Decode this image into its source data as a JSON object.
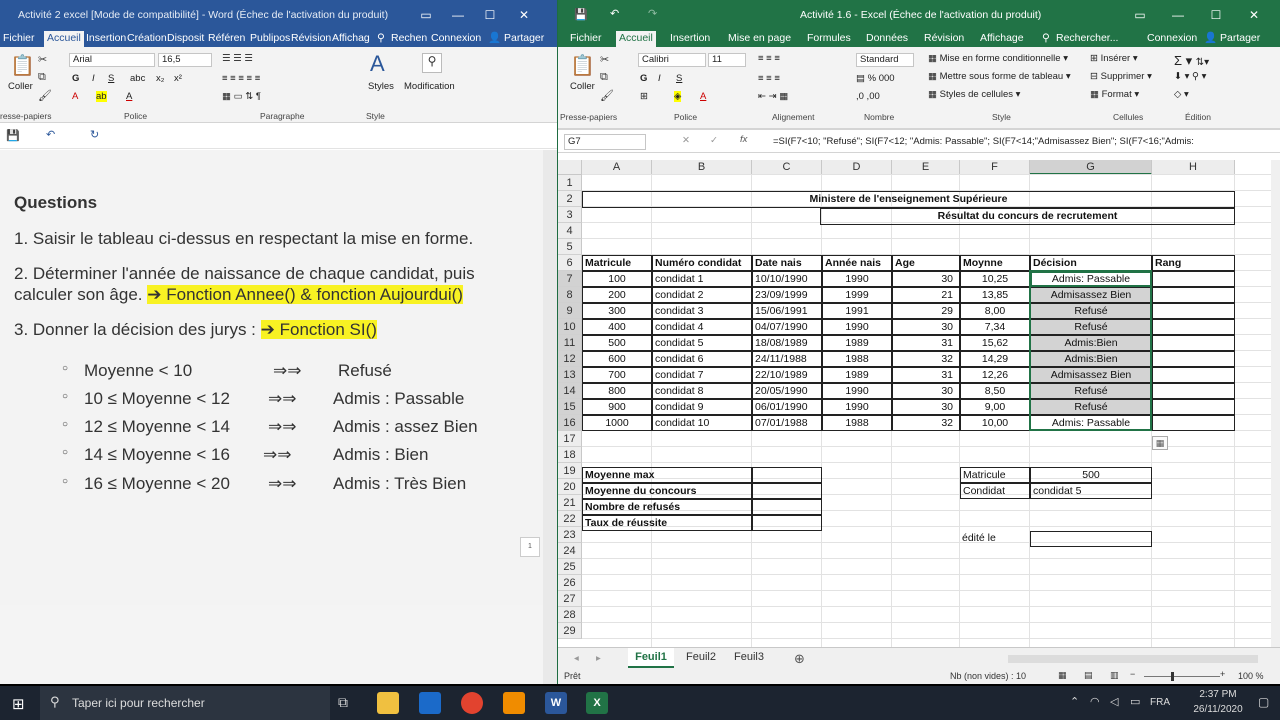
{
  "word": {
    "title": "Activité 2 excel [Mode de compatibilité] - Word (Échec de l'activation du produit)",
    "tabs": [
      "Fichier",
      "Accueil",
      "Insertion",
      "Création",
      "Disposit",
      "Référen",
      "Publipos",
      "Révision",
      "Affichag"
    ],
    "search": "Rechen",
    "connexion": "Connexion",
    "share": "Partager",
    "ribbon": {
      "paste": "Coller",
      "font": "Arial",
      "size": "16,5",
      "styles": "Styles",
      "modification": "Modification",
      "groups": [
        "resse-papiers",
        "Police",
        "Paragraphe",
        "Style"
      ]
    },
    "doc": {
      "heading": "Questions",
      "q1": "1. Saisir le tableau ci-dessus en respectant la mise en forme.",
      "q2a": "2. Déterminer l'année de naissance de chaque candidat, puis",
      "q2b": "calculer son âge.",
      "q2hl": "➔ Fonction Annee() & fonction Aujourdui()",
      "q3": "3. Donner la décision des jurys :",
      "q3hl": "➔ Fonction SI()",
      "rules": [
        {
          "cond": "Moyenne < 10",
          "arrow": "⇒⇒",
          "res": "Refusé"
        },
        {
          "cond": "10 ≤ Moyenne < 12",
          "arrow": "⇒⇒",
          "res": "Admis : Passable"
        },
        {
          "cond": "12 ≤ Moyenne < 14",
          "arrow": "⇒⇒",
          "res": "Admis : assez Bien"
        },
        {
          "cond": "14 ≤ Moyenne < 16",
          "arrow": "⇒⇒",
          "res": "Admis : Bien"
        },
        {
          "cond": "16 ≤ Moyenne < 20",
          "arrow": "⇒⇒",
          "res": "Admis : Très Bien"
        }
      ],
      "page_marker": "1"
    }
  },
  "excel": {
    "title": "Activité 1.6 - Excel (Échec de l'activation du produit)",
    "tabs": [
      "Fichier",
      "Accueil",
      "Insertion",
      "Mise en page",
      "Formules",
      "Données",
      "Révision",
      "Affichage"
    ],
    "search": "Rechercher...",
    "connexion": "Connexion",
    "share": "Partager",
    "ribbon": {
      "paste": "Coller",
      "font": "Calibri",
      "size": "11",
      "numformat": "Standard",
      "cond_format": "Mise en forme conditionnelle",
      "table_format": "Mettre sous forme de tableau",
      "cell_styles": "Styles de cellules",
      "insert": "Insérer",
      "delete": "Supprimer",
      "format": "Format",
      "groups": [
        "Presse-papiers",
        "Police",
        "Alignement",
        "Nombre",
        "Style",
        "Cellules",
        "Édition"
      ]
    },
    "namebox": "G7",
    "formula": "=SI(F7<10; \"Refusé\"; SI(F7<12; \"Admis: Passable\"; SI(F7<14;\"Admisassez Bien\"; SI(F7<16;\"Admis:",
    "columns": [
      "A",
      "B",
      "C",
      "D",
      "E",
      "F",
      "G",
      "H"
    ],
    "rows": [
      "1",
      "2",
      "3",
      "4",
      "5",
      "6",
      "7",
      "8",
      "9",
      "10",
      "11",
      "12",
      "13",
      "14",
      "15",
      "16",
      "17",
      "18",
      "19",
      "20",
      "21",
      "22",
      "23",
      "24",
      "25",
      "26",
      "27",
      "28",
      "29"
    ],
    "title1": "Ministere de l'enseignement Supérieure",
    "title2": "Résultat du concurs de recrutement",
    "headers": [
      "Matricule",
      "Numéro condidat",
      "Date nais",
      "Année nais",
      "Age",
      "Moynne",
      "Décision",
      "Rang"
    ],
    "data": [
      [
        "100",
        "condidat 1",
        "10/10/1990",
        "1990",
        "30",
        "10,25",
        "Admis: Passable"
      ],
      [
        "200",
        "condidat 2",
        "23/09/1999",
        "1999",
        "21",
        "13,85",
        "Admisassez Bien"
      ],
      [
        "300",
        "condidat 3",
        "15/06/1991",
        "1991",
        "29",
        "8,00",
        "Refusé"
      ],
      [
        "400",
        "condidat 4",
        "04/07/1990",
        "1990",
        "30",
        "7,34",
        "Refusé"
      ],
      [
        "500",
        " condidat 5",
        "18/08/1989",
        "1989",
        "31",
        "15,62",
        "Admis:Bien"
      ],
      [
        "600",
        "condidat 6",
        "24/11/1988",
        "1988",
        "32",
        "14,29",
        "Admis:Bien"
      ],
      [
        "700",
        "condidat 7",
        "22/10/1989",
        "1989",
        "31",
        "12,26",
        "Admisassez Bien"
      ],
      [
        "800",
        "condidat 8",
        "20/05/1990",
        "1990",
        "30",
        "8,50",
        "Refusé"
      ],
      [
        "900",
        "condidat 9",
        "06/01/1990",
        "1990",
        "30",
        "9,00",
        "Refusé"
      ],
      [
        "1000",
        "condidat 10",
        "07/01/1988",
        "1988",
        "32",
        "10,00",
        "Admis: Passable"
      ]
    ],
    "stats": [
      "Moyenne max",
      "Moyenne du concours",
      "Nombre de refusés",
      "Taux de réussite"
    ],
    "lookup": {
      "label1": "Matricule",
      "value1": "500",
      "label2": "Condidat",
      "value2": "condidat 5",
      "label3": "édité le"
    },
    "sheets": [
      "Feuil1",
      "Feuil2",
      "Feuil3"
    ],
    "status_left": "Prêt",
    "status_count": "Nb (non vides) : 10",
    "zoom": "100 %"
  },
  "taskbar": {
    "search": "Taper ici pour rechercher",
    "lang": "FRA",
    "time": "2:37 PM",
    "date": "26/11/2020"
  }
}
